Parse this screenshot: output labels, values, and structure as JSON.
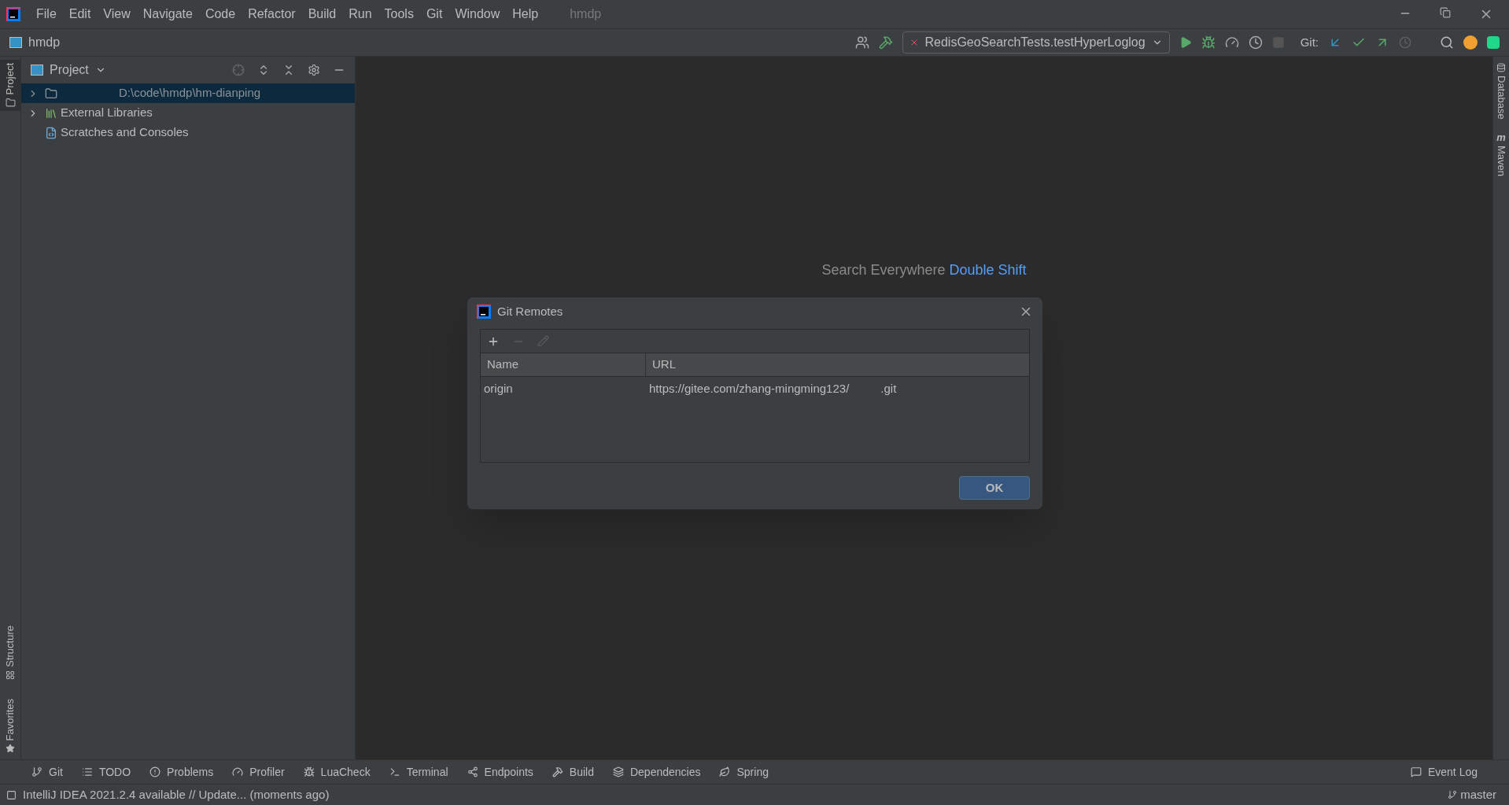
{
  "menu": [
    "File",
    "Edit",
    "View",
    "Navigate",
    "Code",
    "Refactor",
    "Build",
    "Run",
    "Tools",
    "Git",
    "Window",
    "Help"
  ],
  "window": {
    "title": "hmdp"
  },
  "breadcrumb": "hmdp",
  "run_config": "RedisGeoSearchTests.testHyperLoglog",
  "git_label": "Git:",
  "left_stripe": [
    {
      "label": "Project",
      "selected": true
    },
    {
      "label": "Structure",
      "selected": false
    },
    {
      "label": "Favorites",
      "selected": false
    }
  ],
  "right_stripe": [
    {
      "label": "Database",
      "kind": "database"
    },
    {
      "label": "Maven",
      "kind": "maven",
      "icon": "m"
    }
  ],
  "project": {
    "title": "Project",
    "tree": [
      {
        "label": "D:\\code\\hmdp\\hm-dianping",
        "kind": "module",
        "selected": true,
        "expanded": false
      },
      {
        "label": "External Libraries",
        "kind": "libraries",
        "selected": false,
        "expanded": false
      },
      {
        "label": "Scratches and Consoles",
        "kind": "scratches",
        "selected": false
      }
    ]
  },
  "editor_hint": {
    "text": "Search Everywhere",
    "shortcut": "Double Shift"
  },
  "dialog": {
    "title": "Git Remotes",
    "columns": [
      "Name",
      "URL"
    ],
    "rows": [
      {
        "name": "origin",
        "url": "https://gitee.com/zhang-mingming123/",
        "url_end": ".git"
      }
    ],
    "ok": "OK"
  },
  "tool_windows": [
    {
      "label": "Git",
      "kind": "git"
    },
    {
      "label": "TODO",
      "kind": "todo"
    },
    {
      "label": "Problems",
      "kind": "problems"
    },
    {
      "label": "Profiler",
      "kind": "profiler"
    },
    {
      "label": "LuaCheck",
      "kind": "lua"
    },
    {
      "label": "Terminal",
      "kind": "terminal"
    },
    {
      "label": "Endpoints",
      "kind": "endpoints"
    },
    {
      "label": "Build",
      "kind": "build"
    },
    {
      "label": "Dependencies",
      "kind": "deps"
    },
    {
      "label": "Spring",
      "kind": "spring"
    }
  ],
  "event_log": "Event Log",
  "status": {
    "message": "IntelliJ IDEA 2021.2.4 available // Update... (moments ago)",
    "branch": "master"
  }
}
